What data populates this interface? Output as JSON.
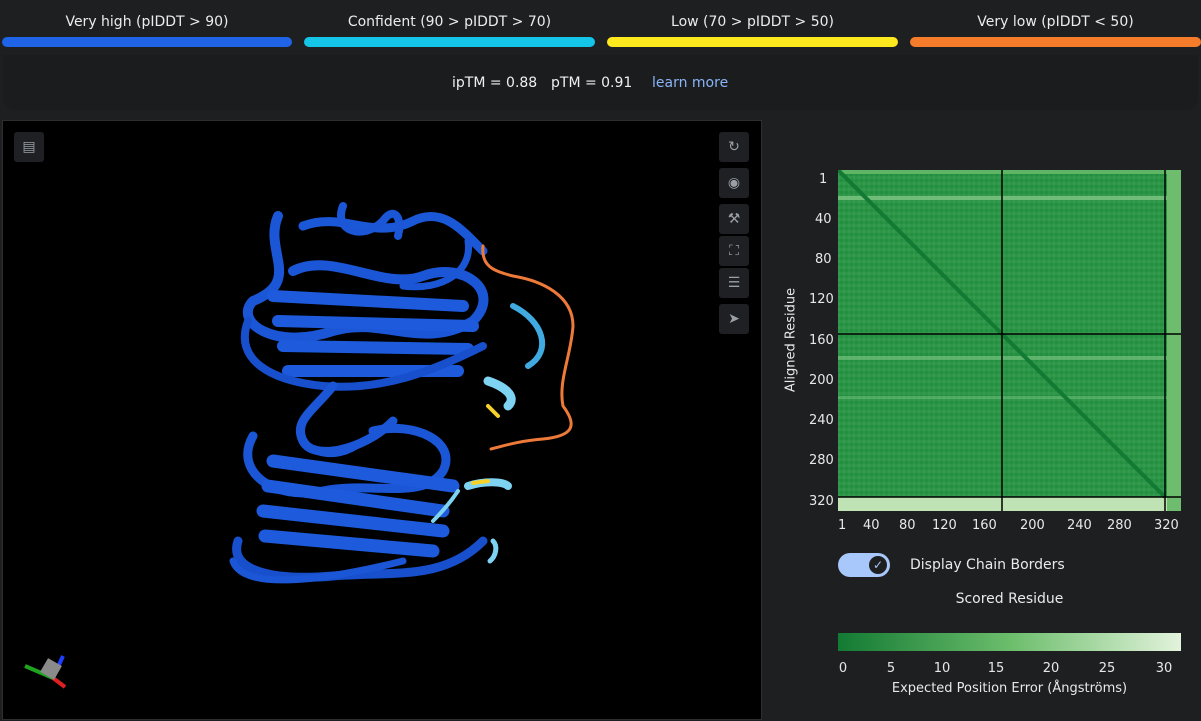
{
  "legend": [
    {
      "label": "Very high (pIDDT > 90)",
      "color": "#1f63e6"
    },
    {
      "label": "Confident (90 > pIDDT > 70)",
      "color": "#14c5e8"
    },
    {
      "label": "Low (70 > pIDDT > 50)",
      "color": "#fee91f"
    },
    {
      "label": "Very low (pIDDT < 50)",
      "color": "#f47c2b"
    }
  ],
  "metrics": {
    "iptm": "ipTM = 0.88",
    "ptm": "pTM = 0.91",
    "learn_more": "learn more"
  },
  "viewer": {
    "tools": [
      "rotate-icon",
      "camera-icon",
      "wrench-icon",
      "fullscreen-icon",
      "sliders-icon",
      "pointer-icon"
    ],
    "top_left_tool": "layers-icon"
  },
  "pae": {
    "y_axis_label": "Aligned Residue",
    "x_axis_label": "Scored Residue",
    "y_ticks": [
      "1",
      "40",
      "80",
      "120",
      "160",
      "200",
      "240",
      "280",
      "320"
    ],
    "x_ticks": [
      "1",
      "40",
      "80",
      "120",
      "160",
      "200",
      "240",
      "280",
      "320"
    ],
    "chain_borders": [
      164,
      317
    ],
    "colorbar_ticks": [
      "0",
      "5",
      "10",
      "15",
      "20",
      "25",
      "30"
    ],
    "colorbar_label": "Expected Position Error (Ångströms)",
    "colors": {
      "low": "#137a33",
      "high": "#e3f3dc"
    }
  },
  "toggle": {
    "label": "Display Chain Borders",
    "checked": true
  }
}
